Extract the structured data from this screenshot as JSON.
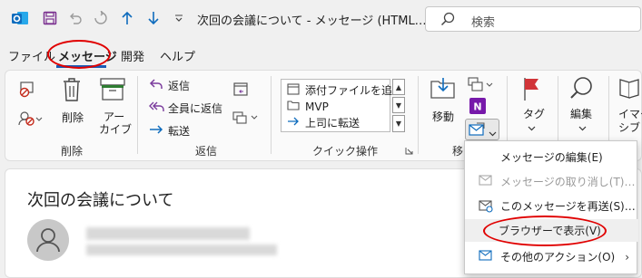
{
  "titlebar": {
    "title": "次回の会議について  -  メッセージ (HTML…",
    "search_placeholder": "検索"
  },
  "tabs": [
    {
      "label": "ファイル"
    },
    {
      "label": "メッセージ",
      "active": true
    },
    {
      "label": "開発"
    },
    {
      "label": "ヘルプ"
    }
  ],
  "ribbon": {
    "delete_group": {
      "delete": "削除",
      "archive_line1": "アー",
      "archive_line2": "カイブ",
      "label": "削除"
    },
    "respond_group": {
      "reply": "返信",
      "reply_all": "全員に返信",
      "forward": "転送",
      "label": "返信"
    },
    "quick_steps": {
      "items": [
        "添付ファイルを追…",
        "MVP",
        "上司に転送"
      ],
      "label": "クイック操作"
    },
    "move_group": {
      "move": "移動",
      "label": "移"
    },
    "tags_group": {
      "tags": "タグ"
    },
    "editing_group": {
      "editing": "編集"
    },
    "immersive_group": {
      "line1": "イマー",
      "line2": "シブ"
    }
  },
  "reading_pane": {
    "subject": "次回の会議について"
  },
  "actions_menu": {
    "items": [
      {
        "label": "メッセージの編集(E)",
        "enabled": true
      },
      {
        "label": "メッセージの取り消し(T)…",
        "enabled": false
      },
      {
        "label": "このメッセージを再送(S)…",
        "enabled": true
      },
      {
        "label": "ブラウザーで表示(V)",
        "enabled": true,
        "highlighted": true
      },
      {
        "label": "その他のアクション(O)",
        "enabled": true,
        "submenu": true
      }
    ]
  },
  "colors": {
    "accent_blue": "#1a5bb5",
    "annotation_red": "#e00000",
    "outlook_blue": "#0f6cbd",
    "onenote_purple": "#7719aa",
    "flag_red": "#d13438"
  }
}
